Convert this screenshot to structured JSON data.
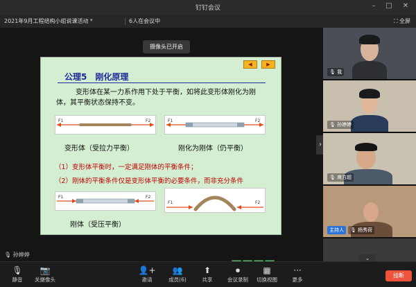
{
  "window": {
    "title": "钉钉会议"
  },
  "infobar": {
    "meeting_name": "2021年9月工程结构小组说课活动",
    "participant_count": "6人在会议中",
    "fullscreen_label": "全屏"
  },
  "stage": {
    "camera_notice": "摄像头已开启",
    "speaker_name": "孙婷婷",
    "slide": {
      "heading_num": "公理5",
      "heading_title": "刚化原理",
      "paragraph": "变形体在某一力系作用下处于平衡，如将此变形体刚化为刚体，其平衡状态保持不变。",
      "label_deformable": "变形体（受拉力平衡）",
      "label_rigid": "刚化为刚体（仍平衡）",
      "condition_1": "（1）变形体平衡时，一定满足刚体的平衡条件；",
      "condition_2": "（2）刚体的平衡条件仅是变形体平衡的必要条件，而非充分条件",
      "label_rigid_compress": "刚体（受压平衡）",
      "force_f1": "F1",
      "force_f2": "F2"
    }
  },
  "participants": [
    {
      "name": "我"
    },
    {
      "name": "孙婷婷"
    },
    {
      "name": "席方超"
    },
    {
      "name": "杨秀荷",
      "badge": "主持人"
    }
  ],
  "toolbar": {
    "mute": "静音",
    "camera": "关摄像头",
    "invite": "邀请",
    "members": "成员(6)",
    "share": "共享",
    "record": "会议录制",
    "switch_view": "切换视图",
    "more": "更多",
    "leave": "挂断"
  },
  "colors": {
    "accent_leave": "#f0533c",
    "host_badge": "#2b72d9",
    "slide_bg": "#d4eed1",
    "slide_heading": "#1a2a9a",
    "slide_red": "#c00000"
  }
}
